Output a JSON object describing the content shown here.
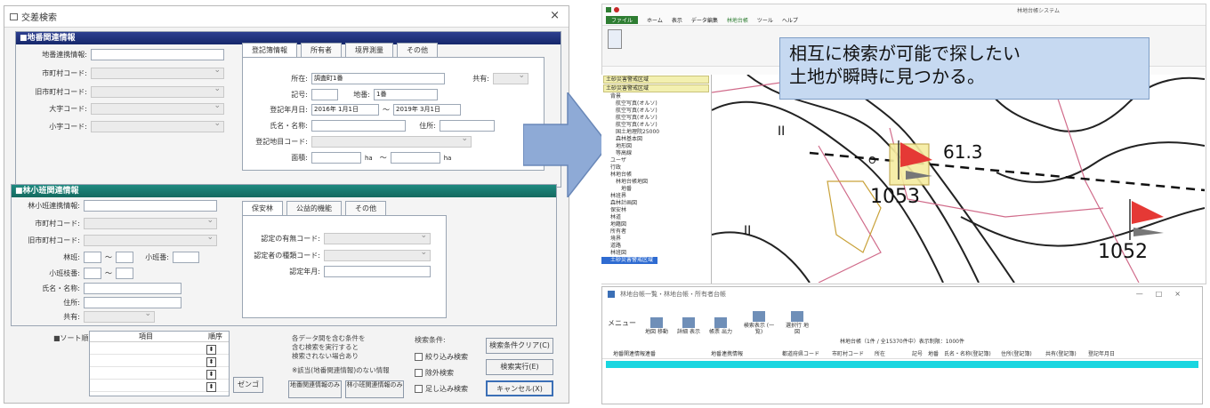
{
  "dialog": {
    "title": "交差検索",
    "close": "×",
    "section1": {
      "header": "■地番関連情報",
      "fields": [
        {
          "label": "地番連携情報:",
          "value": ""
        },
        {
          "label": "市町村コード:",
          "value": ""
        },
        {
          "label": "旧市町村コード:",
          "value": ""
        },
        {
          "label": "大字コード:",
          "value": ""
        },
        {
          "label": "小字コード:",
          "value": ""
        }
      ],
      "tabs": [
        "登記簿情報",
        "所有者",
        "境界測量",
        "その他"
      ],
      "panel": {
        "owner_label": "所在:",
        "owner_value": "調査町1番",
        "kyo_label": "共有:",
        "kigo_label": "記号:",
        "chiban_label": "地番:",
        "chiban_value": "1番",
        "date_label": "登記年月日:",
        "date_from": "2016年 1月1日",
        "date_to": "2019年 3月1日",
        "name_label": "氏名・名称:",
        "addr_label": "住所:",
        "code_label": "登記地目コード:",
        "area_label": "面積:",
        "unit1": "ha",
        "unit2": "ha",
        "tilde": "〜"
      }
    },
    "section2": {
      "header": "■林小班関連情報",
      "fields": [
        {
          "label": "林小班連携情報:"
        },
        {
          "label": "市町村コード:"
        },
        {
          "label": "旧市町村コード:"
        },
        {
          "label": "林班:"
        },
        {
          "label": "小班枝番:"
        },
        {
          "label": "氏名・名称:"
        },
        {
          "label": "住所:"
        },
        {
          "label": "共有:"
        }
      ],
      "sub_label": "小班番:",
      "tilde": "〜",
      "tabs": [
        "保安林",
        "公益的機能",
        "その他"
      ],
      "panel_fields": [
        "認定の有無コード:",
        "認定者の種類コード:",
        "認定年月:"
      ]
    },
    "sort": {
      "label": "■ソート順",
      "col_item": "項目",
      "col_order": "順序"
    },
    "notes": {
      "line1": "各データ間を含む条件を",
      "line2": "含む検索を実行すると",
      "line3": "検索されない場合あり",
      "line4": "※該当(地番関連情報)のない情報"
    },
    "zengo_btn": "ゼンゴ",
    "link_btn1": "地番関連情報のみ",
    "link_btn2": "林小班関連情報のみ",
    "search_label": "検索条件:",
    "checks": [
      "絞り込み検索",
      "除外検索",
      "足し込み検索"
    ],
    "btn_reset": "検索条件クリア(C)",
    "btn_run": "検索実行(E)",
    "btn_cancel": "キャンセル(X)"
  },
  "gis": {
    "title": "林地台帳システム",
    "ribbon": [
      "ファイル",
      "ホーム",
      "表示",
      "データ編集",
      "林地台帳",
      "ツール",
      "ヘルプ"
    ],
    "layer_headers": [
      "土砂災害警戒区域",
      "土砂災害警戒区域"
    ],
    "tree": [
      "背景",
      "航空写真(オルソ)",
      "航空写真(オルソ)",
      "航空写真(オルソ)",
      "航空写真(オルソ)",
      "国土地理院25000",
      "森林基本図",
      "地形図",
      "等高線",
      "ユーザ",
      "行政",
      "林地台帳",
      "林地台帳地図",
      "地番",
      "林班界",
      "森林計画図",
      "保安林",
      "林道",
      "地籍図",
      "所有者",
      "境界",
      "道路",
      "林班図",
      "土砂災害警戒区域"
    ],
    "map_labels": [
      "61.3",
      "1053",
      "1052",
      "II",
      "II",
      "O"
    ]
  },
  "callout": {
    "line1": "相互に検索が可能で探したい",
    "line2": "土地が瞬時に見つかる。"
  },
  "results": {
    "title": "林地台帳一覧・林地台帳・所有者台帳",
    "menu": "メニュー",
    "toolbar": [
      "地図 移動",
      "詳細 表示",
      "帳票 出力",
      "検索表示 (一覧)",
      "選択行 地図"
    ],
    "count": "林地台帳（1件 / 全15370件中）表示制限：1000件",
    "columns": [
      "地番関連情報連番",
      "地番連携情報",
      "都道府県コード",
      "市町村コード",
      "所在",
      "記号",
      "地番",
      "氏名・名称(登記簿)",
      "住所(登記簿)",
      "共有(登記簿)",
      "登記年月日"
    ]
  }
}
